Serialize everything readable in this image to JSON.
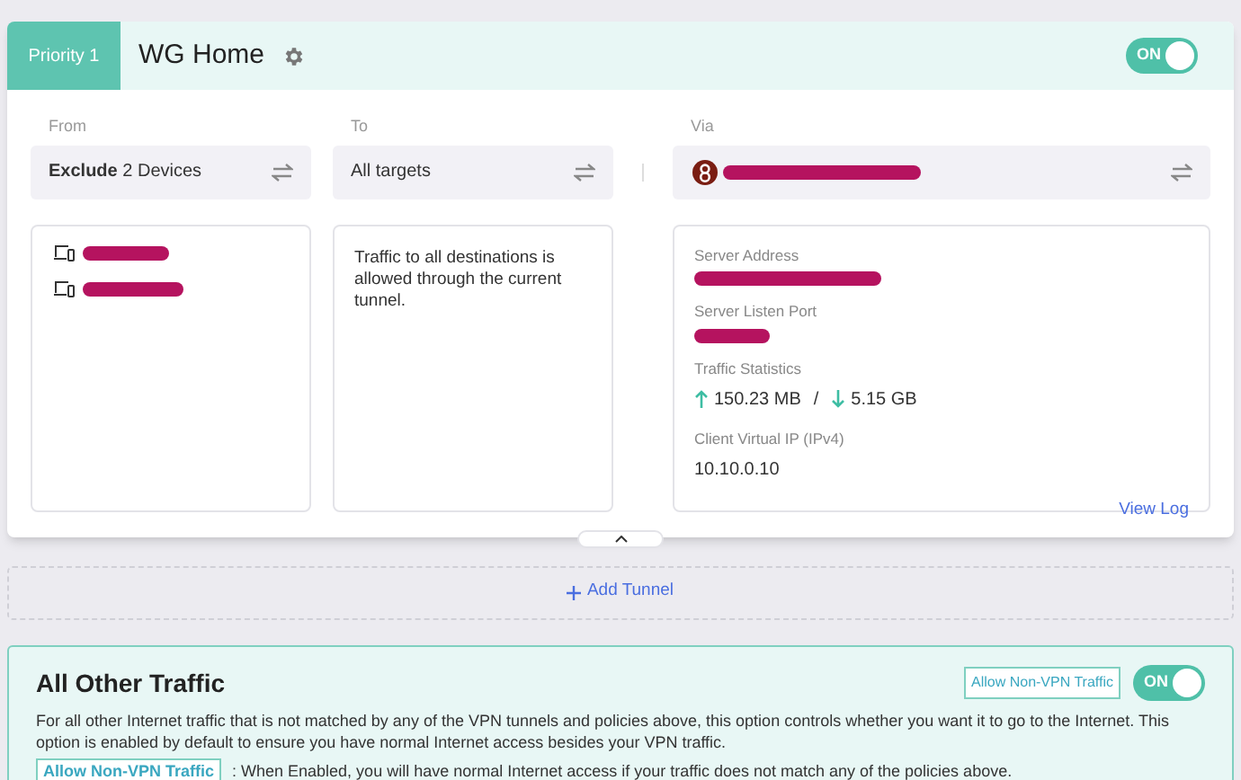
{
  "tunnel": {
    "priority": "Priority 1",
    "name": "WG Home",
    "enabled": true,
    "toggle_label": "ON",
    "from": {
      "label": "From",
      "value": "**Exclude** 2 Devices"
    },
    "to": {
      "label": "To",
      "value": "All targets"
    },
    "via": {
      "label": "Via"
    },
    "devices": [
      {
        "kind": "device"
      },
      {
        "kind": "device"
      }
    ],
    "to_description": "Traffic to all destinations is allowed through the current tunnel.",
    "details": [
      {
        "label": "Server Address",
        "kind": "redacted"
      },
      {
        "label": "Server Listen Port",
        "kind": "redacted"
      },
      {
        "label": "Traffic Statistics",
        "kind": "traffic",
        "upload": "150.23 MB",
        "separator": "/",
        "download": "5.15 GB"
      },
      {
        "label": "Client Virtual IP (IPv4)",
        "kind": "text",
        "value": "10.10.0.10"
      }
    ],
    "view_log": "View Log"
  },
  "add_tunnel": "Add Tunnel",
  "other": {
    "title": "All Other Traffic",
    "tag": "Allow Non-VPN Traffic",
    "enabled": true,
    "toggle_label": "ON",
    "description": "For all other Internet traffic that is not matched by any of the VPN tunnels and policies above, this option controls whether you want it to go to the Internet. This option is enabled by default to ensure you have normal Internet access besides your VPN traffic.",
    "note_tag": "Allow Non-VPN Traffic",
    "note": ": When Enabled, you will have normal Internet access if your traffic does not match any of the policies above."
  }
}
